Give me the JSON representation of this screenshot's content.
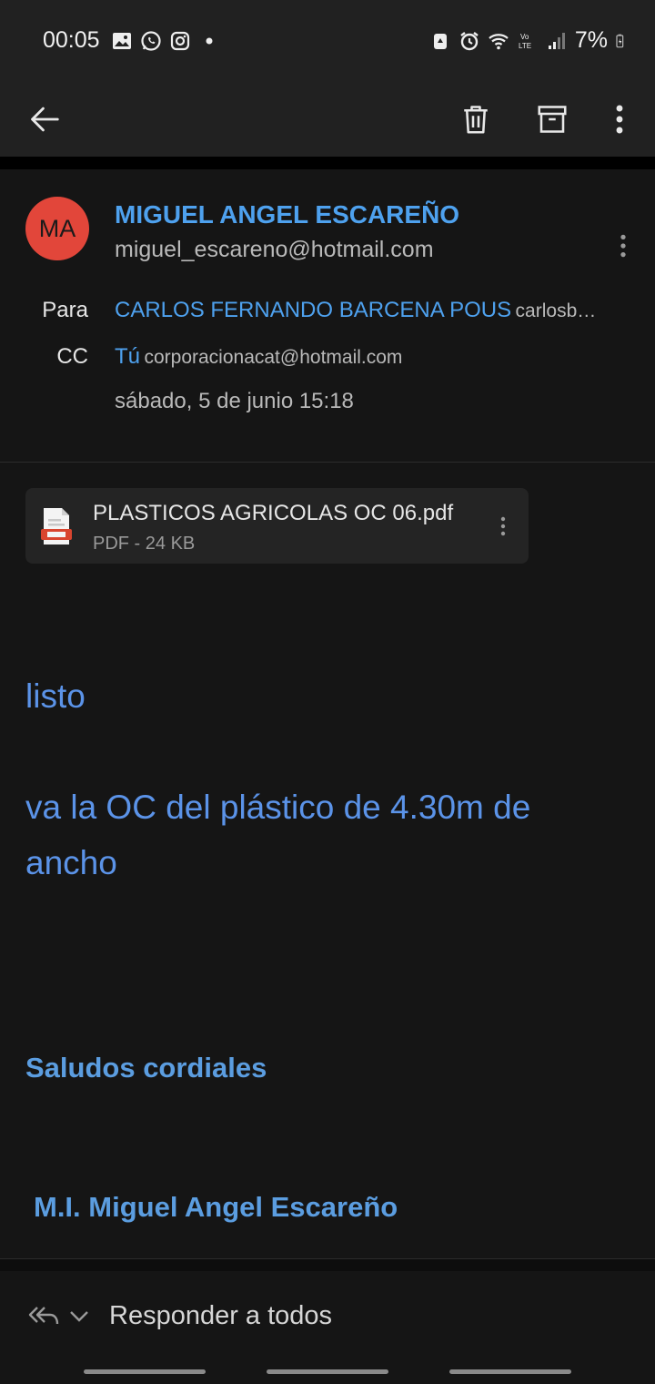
{
  "status_bar": {
    "time": "00:05",
    "battery_percent": "7%",
    "left_icons": [
      "gallery-icon",
      "whatsapp-icon",
      "instagram-icon",
      "dot-icon"
    ],
    "right_icons": [
      "recycle-icon",
      "alarm-icon",
      "wifi-icon",
      "volte-icon",
      "signal-icon",
      "battery-charging-icon"
    ]
  },
  "toolbar": {
    "back_icon": "arrow-left-icon",
    "delete_icon": "trash-icon",
    "archive_icon": "archive-icon",
    "more_icon": "vertical-dots-icon"
  },
  "message": {
    "avatar_initials": "MA",
    "avatar_color": "#e2463a",
    "sender_name": "MIGUEL ANGEL ESCAREÑO",
    "sender_email": "miguel_escareno@hotmail.com",
    "to_label": "Para",
    "to_name": "CARLOS FERNANDO BARCENA POUS",
    "to_addr": "carlosb…",
    "cc_label": "CC",
    "cc_name": "Tú",
    "cc_addr": "corporacionacat@hotmail.com",
    "date": "sábado, 5 de junio 15:18"
  },
  "attachment": {
    "file_name": "PLASTICOS AGRICOLAS OC 06.pdf",
    "file_meta": "PDF - 24 KB",
    "icon": "pdf-file-icon"
  },
  "body": {
    "line1": "listo",
    "line2": "va la OC del plástico de 4.30m de",
    "line3": "ancho",
    "greeting": "Saludos cordiales",
    "signature": "M.I. Miguel Angel Escareño"
  },
  "reply_bar": {
    "label": "Responder a todos",
    "icon": "reply-all-icon"
  },
  "colors": {
    "accent": "#4ea1ee",
    "body_text": "#5b93e8",
    "background": "#151515",
    "bar": "#212121"
  }
}
